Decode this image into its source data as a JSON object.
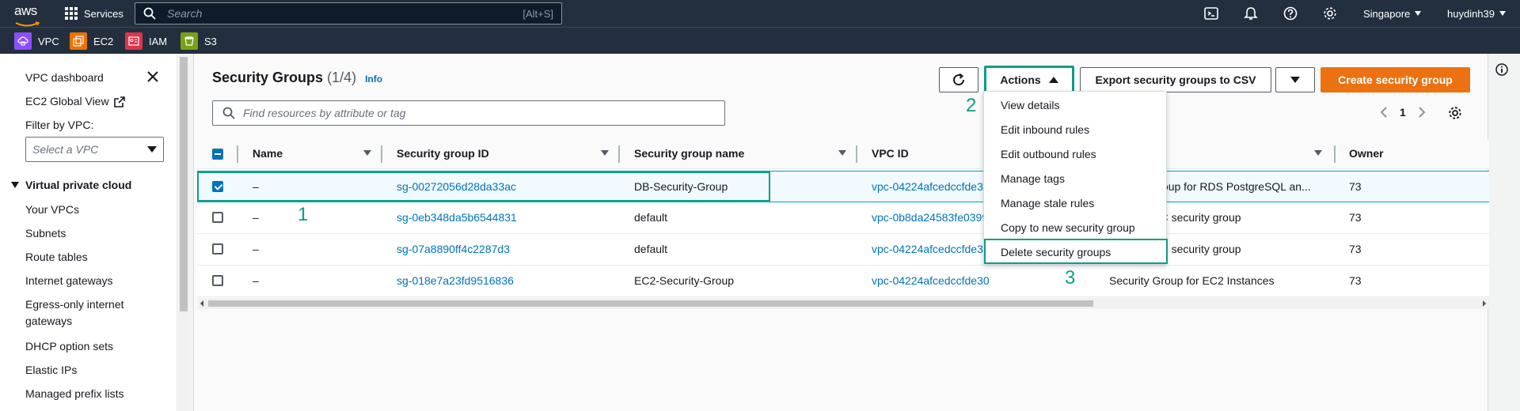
{
  "topnav": {
    "logo": "aws",
    "services": "Services",
    "search_placeholder": "Search",
    "search_shortcut": "[Alt+S]",
    "region": "Singapore",
    "user": "huydinh39"
  },
  "favorites": [
    {
      "label": "VPC",
      "color": "#8c4fff"
    },
    {
      "label": "EC2",
      "color": "#ed7100"
    },
    {
      "label": "IAM",
      "color": "#dd344c"
    },
    {
      "label": "S3",
      "color": "#7aa116"
    }
  ],
  "sidebar": {
    "dashboard": "VPC dashboard",
    "global_view": "EC2 Global View",
    "filter_label": "Filter by VPC:",
    "filter_placeholder": "Select a VPC",
    "section": "Virtual private cloud",
    "items": [
      "Your VPCs",
      "Subnets",
      "Route tables",
      "Internet gateways",
      "Egress-only internet",
      "gateways",
      "DHCP option sets",
      "Elastic IPs",
      "Managed prefix lists"
    ]
  },
  "main": {
    "title": "Security Groups",
    "count": "(1/4)",
    "info": "Info",
    "actions": "Actions",
    "export": "Export security groups to CSV",
    "create": "Create security group",
    "filter_placeholder": "Find resources by attribute or tag",
    "page": "1",
    "columns": [
      "Name",
      "Security group ID",
      "Security group name",
      "VPC ID",
      "Owner"
    ],
    "rows": [
      {
        "name": "–",
        "id": "sg-00272056d28da33ac",
        "group_name": "DB-Security-Group",
        "vpc": "vpc-04224afcedccfde30",
        "desc": "Security group for RDS PostgreSQL an...",
        "owner": "73"
      },
      {
        "name": "–",
        "id": "sg-0eb348da5b6544831",
        "group_name": "default",
        "vpc": "vpc-0b8da24583fe0399",
        "desc": "default VPC security group",
        "owner": "73"
      },
      {
        "name": "–",
        "id": "sg-07a8890ff4c2287d3",
        "group_name": "default",
        "vpc": "vpc-04224afcedccfde30",
        "desc": "default VPC security group",
        "owner": "73"
      },
      {
        "name": "–",
        "id": "sg-018e7a23fd9516836",
        "group_name": "EC2-Security-Group",
        "vpc": "vpc-04224afcedccfde30",
        "desc": "Security Group for EC2 Instances",
        "owner": "73"
      }
    ]
  },
  "menu": {
    "items": [
      "View details",
      "Edit inbound rules",
      "Edit outbound rules",
      "Manage tags",
      "Manage stale rules",
      "Copy to new security group",
      "Delete security groups"
    ]
  },
  "steps": [
    "1",
    "2",
    "3"
  ],
  "colors": {
    "accent": "#0f9d84",
    "link": "#0073bb",
    "primary": "#ec7211"
  }
}
